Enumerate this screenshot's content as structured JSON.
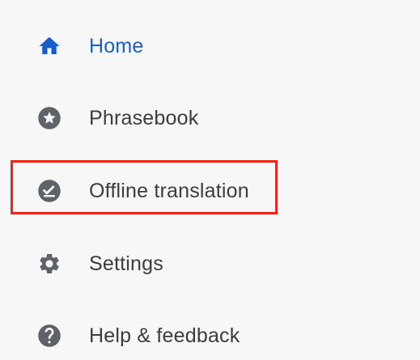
{
  "menu": {
    "items": [
      {
        "label": "Home",
        "icon": "home-icon",
        "active": true
      },
      {
        "label": "Phrasebook",
        "icon": "star-circle-icon",
        "active": false
      },
      {
        "label": "Offline translation",
        "icon": "offline-check-icon",
        "active": false
      },
      {
        "label": "Settings",
        "icon": "gear-icon",
        "active": false
      },
      {
        "label": "Help & feedback",
        "icon": "help-icon",
        "active": false
      }
    ]
  },
  "colors": {
    "active": "#1a5dc8",
    "text": "#3c3c3c",
    "icon": "#5f6368",
    "highlight": "#e8281f",
    "background": "#f7f7f7"
  }
}
